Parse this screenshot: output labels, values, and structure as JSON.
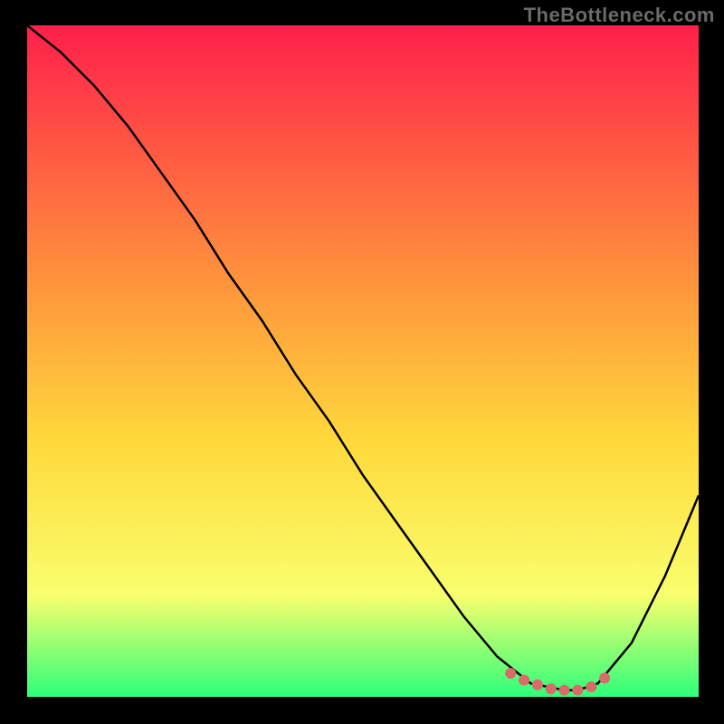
{
  "watermark": "TheBottleneck.com",
  "colors": {
    "frame": "#000000",
    "curve": "#000000",
    "marker": "#d96b6b",
    "gradient_top": "#ff1f4b",
    "gradient_mid1": "#ff8a3d",
    "gradient_mid2": "#ffd93b",
    "gradient_mid3": "#f8ff6e",
    "gradient_bottom": "#2dff7a"
  },
  "chart_data": {
    "type": "line",
    "title": "",
    "xlabel": "",
    "ylabel": "",
    "xlim": [
      0,
      100
    ],
    "ylim": [
      0,
      100
    ],
    "series": [
      {
        "name": "bottleneck-curve",
        "x": [
          0,
          5,
          10,
          15,
          20,
          25,
          30,
          35,
          40,
          45,
          50,
          55,
          60,
          65,
          70,
          75,
          80,
          82,
          85,
          90,
          95,
          100
        ],
        "y": [
          100,
          96,
          91,
          85,
          78,
          71,
          63,
          56,
          48,
          41,
          33,
          26,
          19,
          12,
          6,
          2,
          1,
          1,
          2,
          8,
          18,
          30
        ]
      }
    ],
    "markers": {
      "name": "valley-markers",
      "x": [
        72,
        74,
        76,
        78,
        80,
        82,
        84,
        86
      ],
      "y": [
        3.5,
        2.5,
        1.8,
        1.2,
        1.0,
        1.0,
        1.5,
        2.8
      ]
    }
  }
}
